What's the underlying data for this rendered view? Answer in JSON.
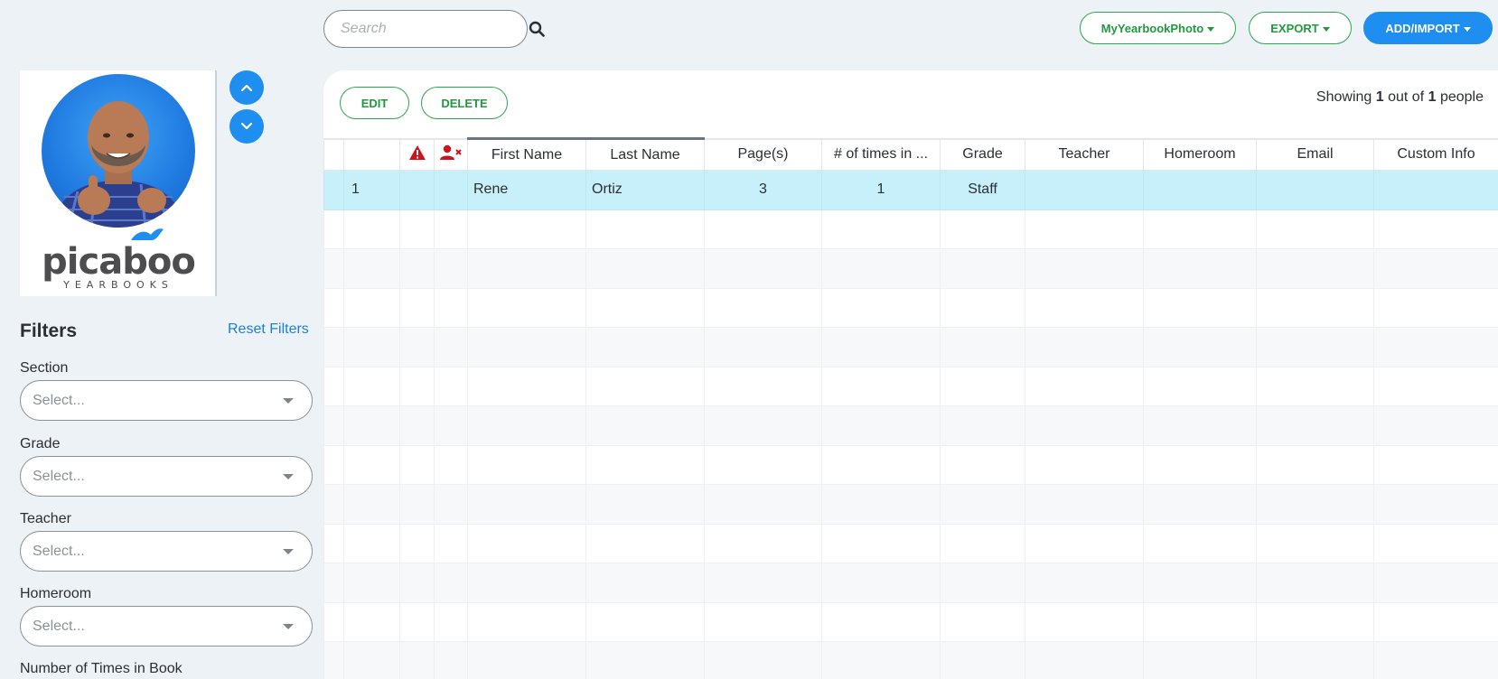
{
  "search": {
    "placeholder": "Search"
  },
  "header_buttons": {
    "mybook": "MyYearbookPhoto",
    "export": "EXPORT",
    "add": "ADD/IMPORT"
  },
  "logo": {
    "word": "picaboo",
    "sub": "YEARBOOKS"
  },
  "filters": {
    "title": "Filters",
    "reset": "Reset Filters",
    "items": [
      {
        "label": "Section",
        "value": "Select..."
      },
      {
        "label": "Grade",
        "value": "Select..."
      },
      {
        "label": "Teacher",
        "value": "Select..."
      },
      {
        "label": "Homeroom",
        "value": "Select..."
      }
    ],
    "next_label": "Number of Times in Book"
  },
  "actions": {
    "edit": "EDIT",
    "delete": "DELETE"
  },
  "showing": {
    "prefix": "Showing",
    "count": "1",
    "middle": "out of",
    "total": "1",
    "suffix": "people"
  },
  "table": {
    "headers": {
      "first_name": "First Name",
      "last_name": "Last Name",
      "pages": "Page(s)",
      "times": "# of times in ...",
      "grade": "Grade",
      "teacher": "Teacher",
      "homeroom": "Homeroom",
      "email": "Email",
      "custom": "Custom Info"
    },
    "rows": [
      {
        "index": "1",
        "first_name": "Rene",
        "last_name": "Ortiz",
        "pages": "3",
        "times": "1",
        "grade": "Staff",
        "teacher": "",
        "homeroom": "",
        "email": "",
        "custom": ""
      }
    ]
  },
  "colors": {
    "accent_blue": "#1e8ff0",
    "accent_green": "#1f9a3c",
    "selected_row": "#c8f0fb",
    "warning_red": "#d0121b"
  },
  "icons": [
    "search-icon",
    "warning-icon",
    "user-remove-icon",
    "chevron-up-icon",
    "chevron-down-icon",
    "dropdown-caret-icon"
  ]
}
